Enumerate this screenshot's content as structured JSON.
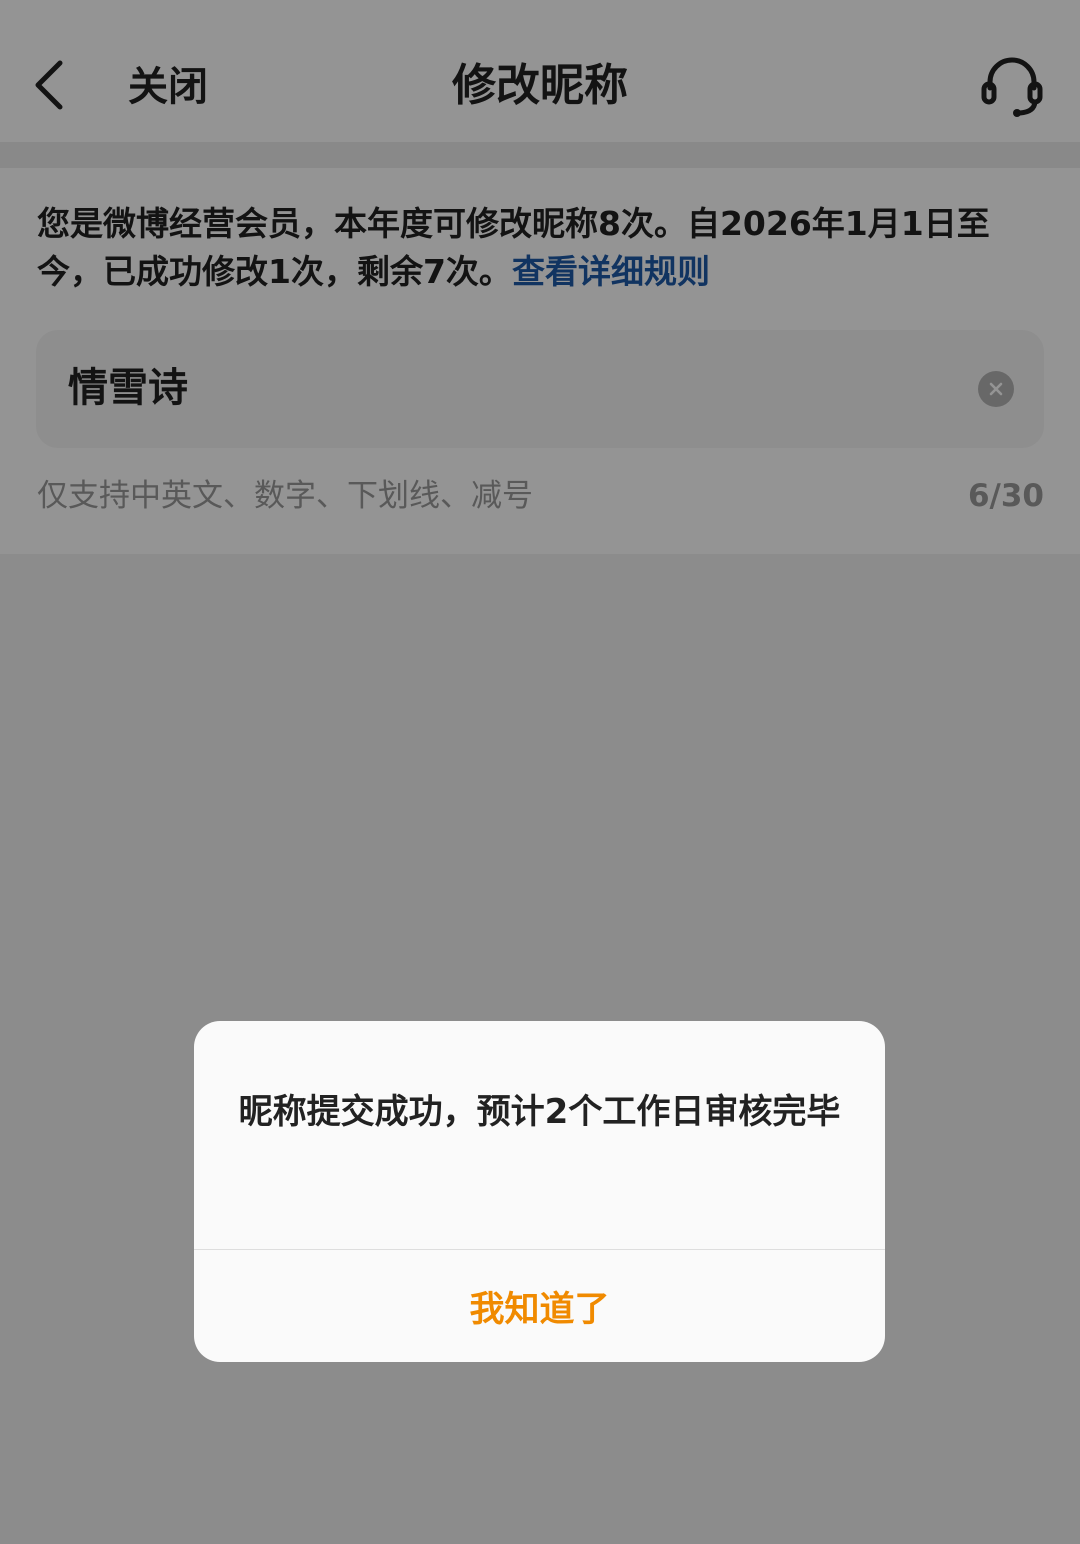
{
  "navbar": {
    "close_label": "关闭",
    "title": "修改昵称",
    "back_icon": "chevron-left-icon",
    "support_icon": "headset-icon"
  },
  "notice": {
    "text": "您是微博经营会员，本年度可修改昵称8次。自2026年1月1日至今，已成功修改1次，剩余7次。",
    "link": "查看详细规则"
  },
  "nickname": {
    "value": "情雪诗",
    "hint": "仅支持中英文、数字、下划线、减号",
    "counter": "6/30"
  },
  "dialog": {
    "message": "昵称提交成功，预计2个工作日审核完毕",
    "confirm_label": "我知道了"
  },
  "colors": {
    "accent": "#f08a00",
    "link": "#1e5aa8",
    "overlay": "rgba(0,0,0,0.42)"
  }
}
